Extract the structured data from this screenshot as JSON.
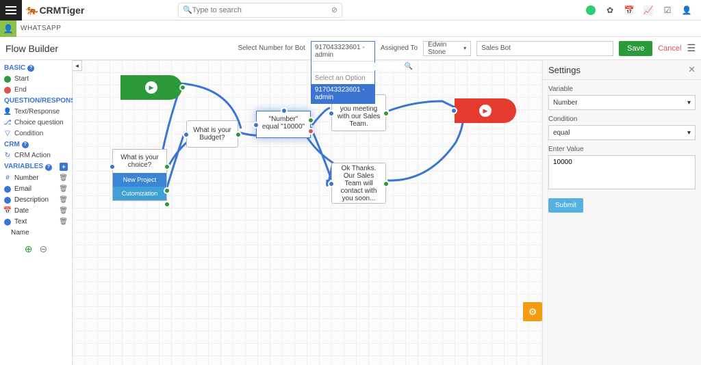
{
  "app": {
    "brand": "CRMTiger",
    "module": "WHATSAPP",
    "search_placeholder": "Type to search"
  },
  "page": {
    "title": "Flow Builder",
    "select_bot_label": "Select Number for Bot",
    "assigned_label": "Assigned To",
    "bot_selected": "917043323601 - admin",
    "assigned_value": "Edwin Stone",
    "flow_name": "Sales Bot",
    "save": "Save",
    "cancel": "Cancel"
  },
  "dropdown": {
    "placeholder": "Select an Option",
    "item": "917043323601 - admin"
  },
  "sidebar": {
    "sec_basic": "BASIC",
    "item_start": "Start",
    "item_end": "End",
    "sec_qr": "QUESTION/RESPONSE",
    "item_text": "Text/Response",
    "item_choice": "Choice question",
    "item_condition": "Condition",
    "sec_crm": "CRM",
    "item_crmaction": "CRM Action",
    "sec_vars": "VARIABLES",
    "vars": [
      {
        "name": "Number"
      },
      {
        "name": "Email"
      },
      {
        "name": "Description"
      },
      {
        "name": "Date"
      },
      {
        "name": "Text"
      },
      {
        "name": "Name"
      }
    ]
  },
  "nodes": {
    "choice_q": "What is your choice?",
    "choice_op1": "New Project",
    "choice_op2": "Cutomization",
    "budget": "What is your Budget?",
    "condition": "\"Number\" equal \"10000\"",
    "msg_meet": "We will set you meeting with our Sales Team.",
    "msg_contact": "Ok Thanks. Our Sales Team will contact with you soon..."
  },
  "settings": {
    "title": "Settings",
    "lbl_variable": "Variable",
    "val_variable": "Number",
    "lbl_condition": "Condition",
    "val_condition": "equal",
    "lbl_enter": "Enter Value",
    "val_enter": "10000",
    "submit": "Submit"
  },
  "chart_data": {
    "type": "diagram",
    "description": "Flow builder directed graph",
    "nodes": [
      {
        "id": "start",
        "type": "start"
      },
      {
        "id": "choice",
        "type": "choice",
        "label": "What is your choice?",
        "options": [
          "New Project",
          "Cutomization"
        ]
      },
      {
        "id": "budget",
        "type": "question",
        "label": "What is your Budget?"
      },
      {
        "id": "cond",
        "type": "condition",
        "label": "\"Number\" equal \"10000\""
      },
      {
        "id": "meet",
        "type": "message",
        "label": "We will set you meeting with our Sales Team."
      },
      {
        "id": "contact",
        "type": "message",
        "label": "Ok Thanks. Our Sales Team will contact with you soon..."
      },
      {
        "id": "end",
        "type": "end"
      }
    ],
    "edges": [
      [
        "start",
        "choice"
      ],
      [
        "choice",
        "budget"
      ],
      [
        "budget",
        "cond"
      ],
      [
        "cond",
        "meet"
      ],
      [
        "cond",
        "contact"
      ],
      [
        "meet",
        "end"
      ],
      [
        "contact",
        "end"
      ]
    ]
  }
}
